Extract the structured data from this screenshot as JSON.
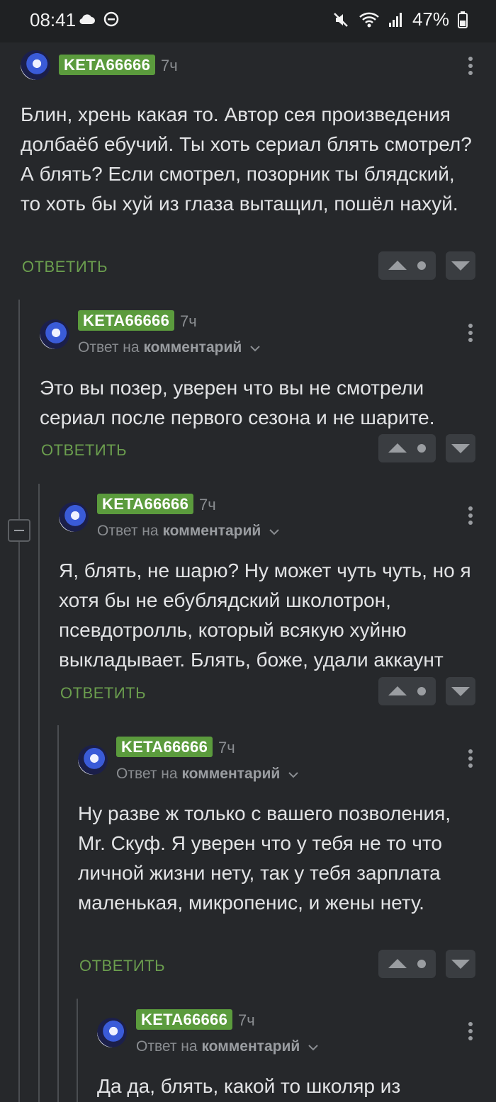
{
  "status_bar": {
    "time": "08:41",
    "battery": "47%",
    "icons": [
      "cloud-icon",
      "dnd-icon",
      "mute-icon",
      "wifi-icon",
      "signal-icon",
      "battery-icon"
    ]
  },
  "comments": [
    {
      "username": "KETA66666",
      "time": "7ч",
      "reply_prefix": "",
      "reply_target": "",
      "text": "Блин, хрень какая то. Автор сея произведения долбаёб ебучий. Ты хоть сериал блять смотрел? А блять? Если смотрел, позорник ты блядский, то хоть бы хуй из глаза вытащил, пошёл нахуй.",
      "reply_label": "ОТВЕТИТЬ"
    },
    {
      "username": "KETA66666",
      "time": "7ч",
      "reply_prefix": "Ответ на",
      "reply_target": "комментарий",
      "text": "Это вы позер, уверен что вы не смотрели сериал после первого сезона и не шарите.",
      "reply_label": "ОТВЕТИТЬ"
    },
    {
      "username": "KETA66666",
      "time": "7ч",
      "reply_prefix": "Ответ на",
      "reply_target": "комментарий",
      "text": "Я, блять, не шарю? Ну может чуть чуть, но я хотя бы не ебублядский школотрон, псевдотролль, который всякую хуйню выкладывает. Блять, боже, удали аккаунт",
      "reply_label": "ОТВЕТИТЬ"
    },
    {
      "username": "KETA66666",
      "time": "7ч",
      "reply_prefix": "Ответ на",
      "reply_target": "комментарий",
      "text": "Ну разве ж только с вашего позволения, Mr. Скуф. Я уверен что у тебя не то что личной жизни нету, так у тебя зарплата маленькая, микропенис, и жены нету.",
      "reply_label": "ОТВЕТИТЬ"
    },
    {
      "username": "KETA66666",
      "time": "7ч",
      "reply_prefix": "Ответ на",
      "reply_target": "комментарий",
      "text": "Да да, блять, какой то школяр из",
      "reply_label": ""
    }
  ],
  "colors": {
    "background": "#26282b",
    "username_badge": "#5b9b3d",
    "reply_link": "#6b9e4e",
    "vote_button": "#3a3d41"
  }
}
